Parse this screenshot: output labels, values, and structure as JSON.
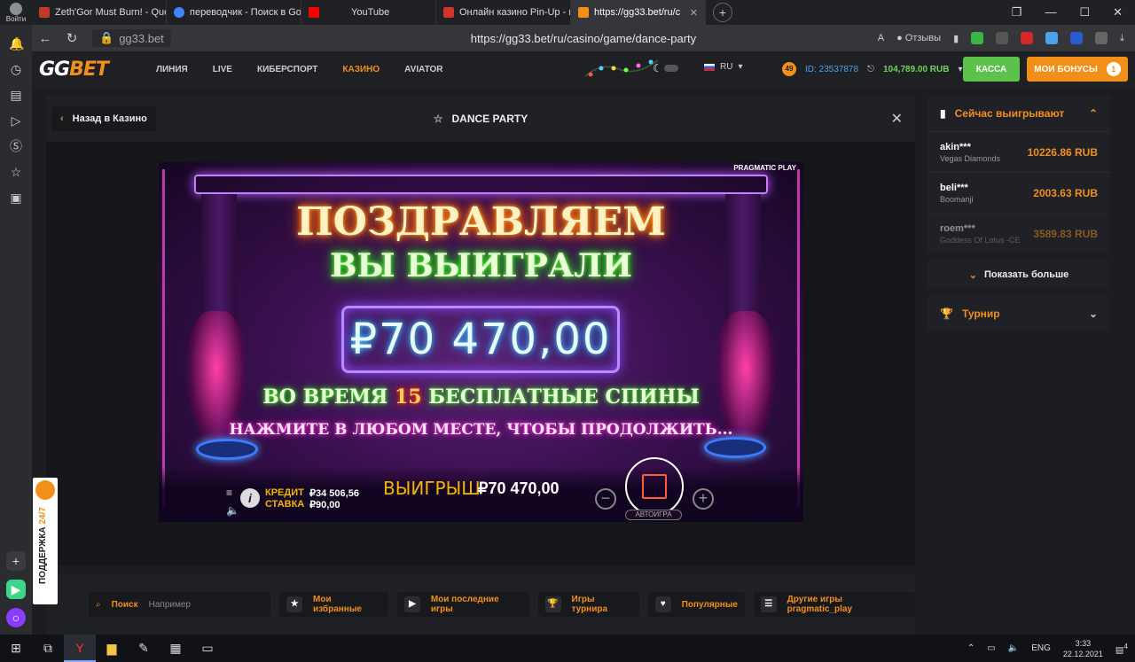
{
  "browser": {
    "profile_label": "Войти",
    "tabs": [
      {
        "label": "Zeth'Gor Must Burn! - Que",
        "color": "#c0392b"
      },
      {
        "label": "переводчик - Поиск в Go",
        "color": "#4285f4"
      },
      {
        "label": "YouTube",
        "color": "#ff0000"
      },
      {
        "label": "Онлайн казино Pin-Up - и",
        "color": "#d0342c"
      },
      {
        "label": "https://gg33.bet/ru/c",
        "color": "#f28f19",
        "active": true
      }
    ],
    "host": "gg33.bet",
    "url": "https://gg33.bet/ru/casino/game/dance-party",
    "reviews_label": "Отзывы"
  },
  "site": {
    "logo_gg": "GG",
    "logo_bet": "BET",
    "menu": [
      "ЛИНИЯ",
      "LIVE",
      "КИБЕРСПОРТ",
      "КАЗИНО",
      "AVIATOR"
    ],
    "lang": "RU",
    "badge_count": "49",
    "account_id": "ID: 23537878",
    "balance": "104,789.00 RUB",
    "cashier_label": "КАССА",
    "bonus_label": "МОИ БОНУСЫ",
    "bonus_count": "1"
  },
  "game_panel": {
    "back_label": "Назад в Казино",
    "title": "DANCE PARTY"
  },
  "game": {
    "provider": "PRAGMATIC PLAY",
    "congrats": "ПОЗДРАВЛЯЕМ",
    "won": "ВЫ ВЫИГРАЛИ",
    "amount": "₽70 470,00",
    "spins_pre": "ВО ВРЕМЯ",
    "spins_num": "15",
    "spins_post": "БЕСПЛАТНЫЕ СПИНЫ",
    "press": "НАЖМИТЕ В ЛЮБОМ МЕСТЕ, ЧТОБЫ ПРОДОЛЖИТЬ...",
    "credit_label": "КРЕДИТ",
    "credit_value": "₽34 506,56",
    "bet_label": "СТАВКА",
    "bet_value": "₽90,00",
    "win_label": "ВЫИГРЫШ",
    "win_value": "₽70 470,00",
    "autoplay_label": "АВТОИГРА"
  },
  "filters": {
    "search_label": "Поиск",
    "search_placeholder": "Например",
    "buttons": [
      "Мои избранные",
      "Мои последние игры",
      "Игры турнира",
      "Популярные",
      "Другие игры pragmatic_play"
    ]
  },
  "winners": {
    "title": "Сейчас выигрывают",
    "rows": [
      {
        "name": "akin***",
        "game": "Vegas Diamonds",
        "amount": "10226.86 RUB"
      },
      {
        "name": "beli***",
        "game": "Boomanji",
        "amount": "2003.63 RUB"
      },
      {
        "name": "roem***",
        "game": "Goddess Of Lotus -CE",
        "amount": "3589.83 RUB"
      }
    ],
    "show_more": "Показать больше",
    "tournament": "Турнир"
  },
  "support": {
    "label": "ПОДДЕРЖКА",
    "label_accent": "24/7"
  },
  "taskbar": {
    "lang": "ENG",
    "time": "3:33",
    "date": "22.12.2021",
    "notif_count": "4"
  }
}
